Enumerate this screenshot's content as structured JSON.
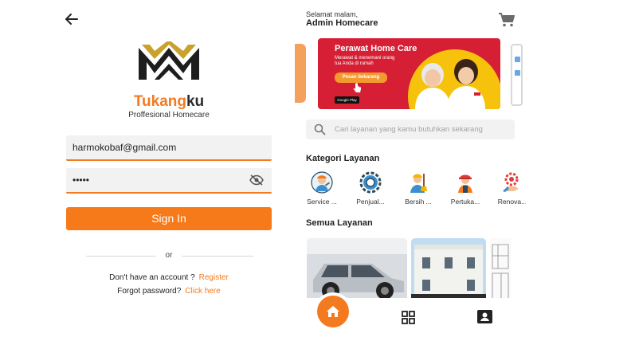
{
  "login": {
    "brand_part1": "Tukang",
    "brand_part2": "ku",
    "tagline": "Proffesional Homecare",
    "email_value": "harmokobaf@gmail.com",
    "password_value": "•••••",
    "sign_in_label": "Sign In",
    "or_label": "or",
    "no_account_text": "Don't have an account ?",
    "register_link": "Register",
    "forgot_text": "Forgot password?",
    "click_here_link": "Click here",
    "accent_color": "#f47a1f"
  },
  "home": {
    "greeting": "Selamat malam,",
    "user_name": "Admin Homecare",
    "banner": {
      "title": "Perawat Home Care",
      "subtitle": "Merawat & menemani orang tua Anda di rumah",
      "button_label": "Pesan Sekarang",
      "badge": "Google Play"
    },
    "search": {
      "placeholder": "Cari layanan yang kamu butuhkan sekarang"
    },
    "categories_title": "Kategori Layanan",
    "categories": [
      {
        "label": "Service ...",
        "icon": "technician-icon"
      },
      {
        "label": "Penjual...",
        "icon": "gear-icon"
      },
      {
        "label": "Bersih ...",
        "icon": "cleaner-icon"
      },
      {
        "label": "Pertuka...",
        "icon": "worker-icon"
      },
      {
        "label": "Renova...",
        "icon": "renovation-icon"
      }
    ],
    "all_services_title": "Semua Layanan",
    "nav": [
      "home-icon",
      "grid-icon",
      "profile-icon"
    ]
  }
}
